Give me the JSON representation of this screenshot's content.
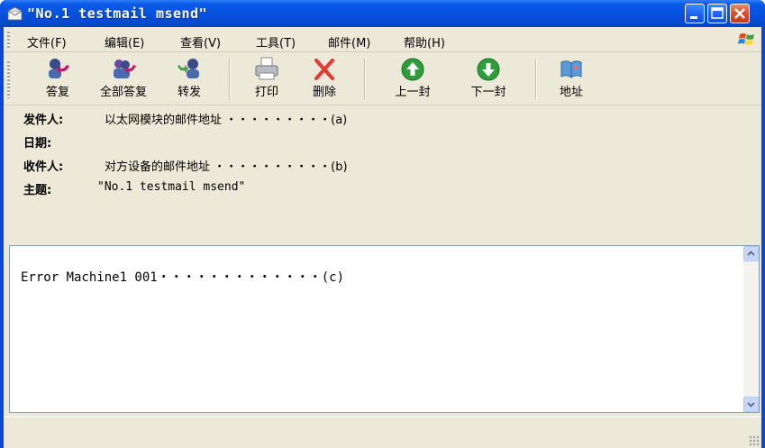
{
  "window": {
    "title": "\"No.1 testmail msend\""
  },
  "menu": {
    "items": [
      "文件(F)",
      "编辑(E)",
      "查看(V)",
      "工具(T)",
      "邮件(M)",
      "帮助(H)"
    ]
  },
  "toolbar": {
    "reply": "答复",
    "reply_all": "全部答复",
    "forward": "转发",
    "print": "打印",
    "delete": "删除",
    "prev": "上一封",
    "next": "下一封",
    "address": "地址"
  },
  "header": {
    "from_label": "发件人:",
    "from_value": "以太网模块的邮件地址 ・・・・・・・・・(a)",
    "date_label": "日期:",
    "date_value": "",
    "to_label": "收件人:",
    "to_value": "对方设备的邮件地址 ・・・・・・・・・・(b)",
    "subject_label": "主题:",
    "subject_value": "\"No.1 testmail msend\""
  },
  "body": {
    "text": "Error Machine1 001・・・・・・・・・・・・・(c)"
  },
  "colors": {
    "titlebar": "#0a5ae8",
    "face": "#ece9d8",
    "close_button": "#d8502a"
  }
}
